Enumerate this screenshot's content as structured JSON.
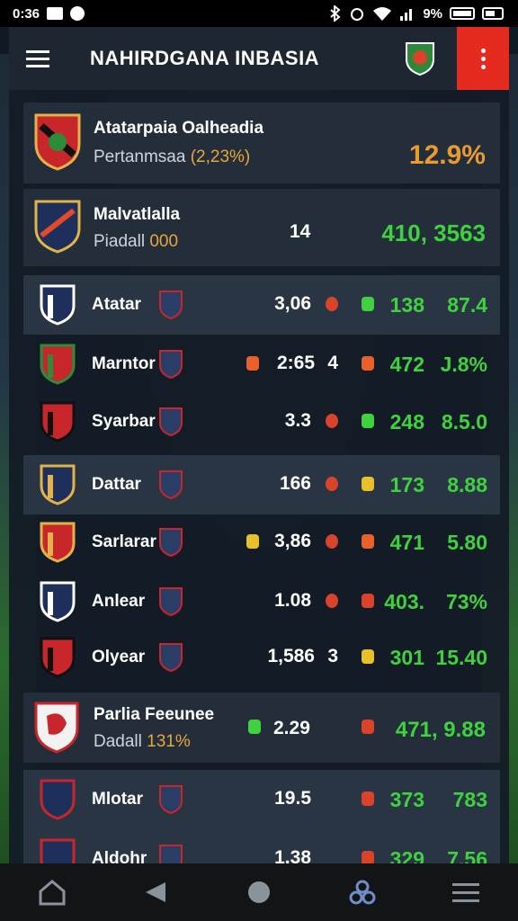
{
  "status": {
    "time": "0:36",
    "battery": "9%"
  },
  "app": {
    "title": "NAHIRDGANA INBASIA"
  },
  "featured": [
    {
      "name": "Atatarpaia Oalheadia",
      "sub_label": "Pertanmsaa",
      "sub_value": "(2,23%)",
      "value": "12.9%"
    },
    {
      "name": "Malvatlalla",
      "sub_label": "Piadall",
      "sub_value": "000",
      "count": "14",
      "value": "410, 3563"
    }
  ],
  "rows": [
    {
      "name": "Atatar",
      "badge_icon": "",
      "col1": "3,06",
      "col2": "",
      "arrow_icon": "up-arrow-icon",
      "v1": "138",
      "v2": "87.4"
    },
    {
      "name": "Marntor",
      "badge_icon": "shield-orange-icon",
      "col1": "2:65",
      "col2": "4",
      "arrow_icon": "shield-orange-icon",
      "v1": "472",
      "v2": "J.8%"
    },
    {
      "name": "Syarbar",
      "badge_icon": "",
      "col1": "3.3",
      "col2": "",
      "arrow_icon": "shield-green-icon",
      "v1": "248",
      "v2": "8.5.0"
    },
    {
      "name": "Dattar",
      "badge_icon": "",
      "col1": "166",
      "col2": "",
      "arrow_icon": "shield-yellow-icon",
      "v1": "173",
      "v2": "8.88"
    },
    {
      "name": "Sarlarar",
      "badge_icon": "shield-yellow-icon",
      "col1": "3,86",
      "col2": "",
      "arrow_icon": "shield-orange-icon",
      "v1": "471",
      "v2": "5.80"
    },
    {
      "name": "Anlear",
      "badge_icon": "",
      "col1": "1.08",
      "col2": "",
      "arrow_icon": "shield-red-icon",
      "v1": "403.",
      "v2": "73%"
    },
    {
      "name": "Olyear",
      "badge_icon": "",
      "col1": "1,586",
      "col2": "3",
      "arrow_icon": "shield-yellow-icon",
      "v1": "301",
      "v2": "15.40"
    }
  ],
  "featured3": {
    "name": "Parlia Feeunee",
    "sub_label": "Dadall",
    "sub_value": "131%",
    "col1": "2.29",
    "value": "471, 9.88"
  },
  "rows2": [
    {
      "name": "Mlotar",
      "col1": "19.5",
      "v1": "373",
      "v2": "783"
    },
    {
      "name": "Aldohr",
      "col1": "1.38",
      "v1": "329",
      "v2": "7.56"
    }
  ],
  "colors": {
    "accent": "#e52b1f",
    "positive": "#3fd13f",
    "highlight": "#e99b2f"
  }
}
